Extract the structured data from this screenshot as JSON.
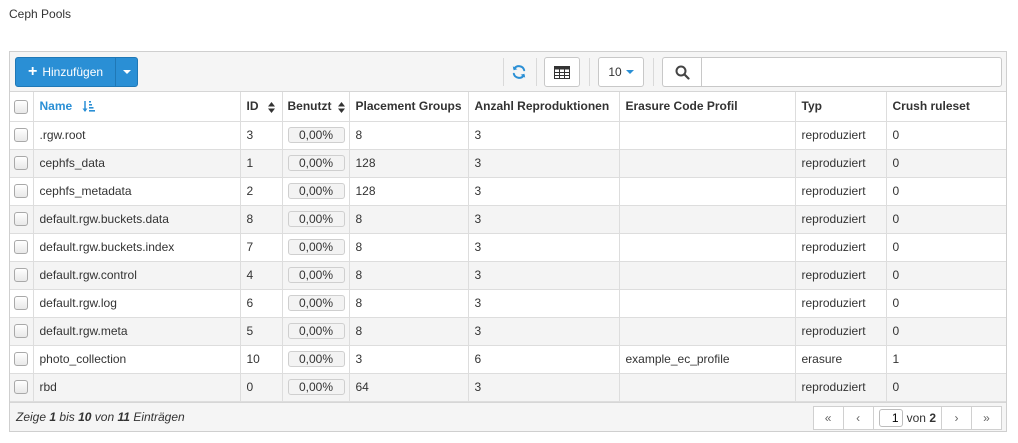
{
  "page": {
    "title": "Ceph Pools"
  },
  "toolbar": {
    "add_label": "Hinzufügen",
    "page_size": "10",
    "search_value": ""
  },
  "table": {
    "columns": [
      "Name",
      "ID",
      "Benutzt",
      "Placement Groups",
      "Anzahl Reproduktionen",
      "Erasure Code Profil",
      "Typ",
      "Crush ruleset"
    ],
    "rows": [
      {
        "name": ".rgw.root",
        "id": "3",
        "used": "0,00%",
        "pg": "8",
        "replicas": "3",
        "ec_profile": "",
        "type": "reproduziert",
        "crush": "0"
      },
      {
        "name": "cephfs_data",
        "id": "1",
        "used": "0,00%",
        "pg": "128",
        "replicas": "3",
        "ec_profile": "",
        "type": "reproduziert",
        "crush": "0"
      },
      {
        "name": "cephfs_metadata",
        "id": "2",
        "used": "0,00%",
        "pg": "128",
        "replicas": "3",
        "ec_profile": "",
        "type": "reproduziert",
        "crush": "0"
      },
      {
        "name": "default.rgw.buckets.data",
        "id": "8",
        "used": "0,00%",
        "pg": "8",
        "replicas": "3",
        "ec_profile": "",
        "type": "reproduziert",
        "crush": "0"
      },
      {
        "name": "default.rgw.buckets.index",
        "id": "7",
        "used": "0,00%",
        "pg": "8",
        "replicas": "3",
        "ec_profile": "",
        "type": "reproduziert",
        "crush": "0"
      },
      {
        "name": "default.rgw.control",
        "id": "4",
        "used": "0,00%",
        "pg": "8",
        "replicas": "3",
        "ec_profile": "",
        "type": "reproduziert",
        "crush": "0"
      },
      {
        "name": "default.rgw.log",
        "id": "6",
        "used": "0,00%",
        "pg": "8",
        "replicas": "3",
        "ec_profile": "",
        "type": "reproduziert",
        "crush": "0"
      },
      {
        "name": "default.rgw.meta",
        "id": "5",
        "used": "0,00%",
        "pg": "8",
        "replicas": "3",
        "ec_profile": "",
        "type": "reproduziert",
        "crush": "0"
      },
      {
        "name": "photo_collection",
        "id": "10",
        "used": "0,00%",
        "pg": "3",
        "replicas": "6",
        "ec_profile": "example_ec_profile",
        "type": "erasure",
        "crush": "1"
      },
      {
        "name": "rbd",
        "id": "0",
        "used": "0,00%",
        "pg": "64",
        "replicas": "3",
        "ec_profile": "",
        "type": "reproduziert",
        "crush": "0"
      }
    ]
  },
  "footer": {
    "prefix": "Zeige",
    "from": "1",
    "bis": "bis",
    "to": "10",
    "von": "von",
    "total": "11",
    "suffix": "Einträgen"
  },
  "pager": {
    "current_page": "1",
    "of_label": "von",
    "total_pages": "2"
  },
  "colors": {
    "primary": "#2a8fd5",
    "toolbar_bg": "#f5f5f5",
    "row_alt": "#f4f4f4",
    "border": "#dddddd"
  },
  "icons": {
    "add": "plus-icon",
    "refresh": "refresh-icon",
    "columns": "table-columns-icon",
    "search": "search-icon",
    "sort_name": "sort-ascending-icon",
    "sort": "sort-icon"
  }
}
